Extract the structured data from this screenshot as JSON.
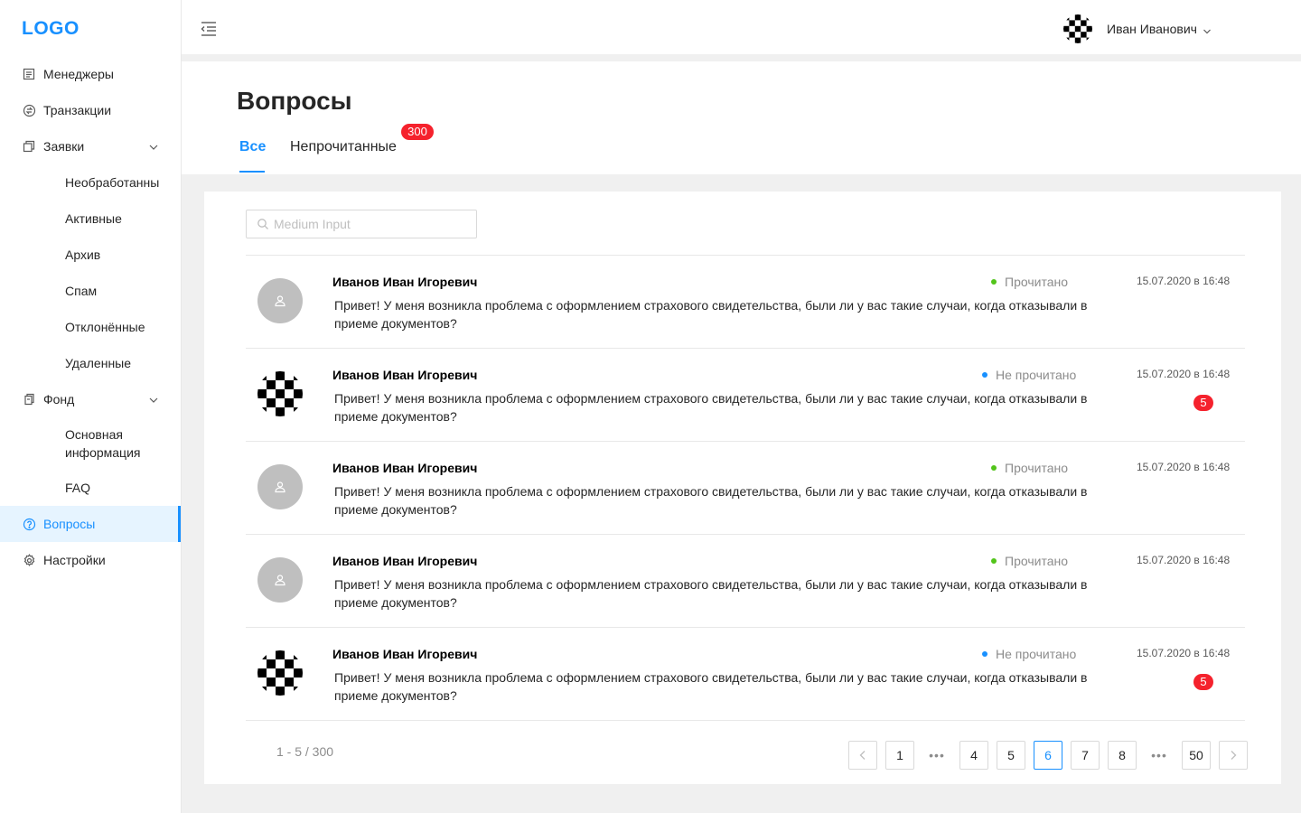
{
  "logo": "LOGO",
  "sidebar": {
    "items": [
      {
        "label": "Менеджеры",
        "icon": "document-list-icon"
      },
      {
        "label": "Транзакции",
        "icon": "transaction-icon"
      },
      {
        "label": "Заявки",
        "icon": "copy-icon",
        "expanded": true
      },
      {
        "label": "Необработанны"
      },
      {
        "label": "Активные"
      },
      {
        "label": "Архив"
      },
      {
        "label": "Спам"
      },
      {
        "label": "Отклонённые"
      },
      {
        "label": "Удаленные"
      },
      {
        "label": "Фонд",
        "icon": "file-icon",
        "expanded": true
      },
      {
        "label": "Основная информация"
      },
      {
        "label": "FAQ"
      },
      {
        "label": "Вопросы",
        "icon": "question-circle-icon",
        "active": true
      },
      {
        "label": "Настройки",
        "icon": "gear-icon"
      }
    ]
  },
  "header": {
    "user_name": "Иван Иванович"
  },
  "page": {
    "title": "Вопросы",
    "tabs": [
      {
        "label": "Все",
        "active": true
      },
      {
        "label": "Непрочитанные",
        "badge": "300"
      }
    ]
  },
  "search": {
    "placeholder": "Medium Input",
    "value": ""
  },
  "questions": [
    {
      "name": "Иванов Иван Игоревич",
      "message": "Привет! У меня возникла проблема с оформлением страхового свидетельства, были ли у вас такие случаи, когда отказывали в приеме документов?",
      "status": "Прочитано",
      "date": "15.07.2020 в 16:48",
      "badge": "",
      "avatar": "default"
    },
    {
      "name": "Иванов Иван Игоревич",
      "message": "Привет! У меня возникла проблема с оформлением страхового свидетельства, были ли у вас такие случаи, когда отказывали в приеме документов?",
      "status": "Не прочитано",
      "date": "15.07.2020 в 16:48",
      "badge": "5",
      "avatar": "checker"
    },
    {
      "name": "Иванов Иван Игоревич",
      "message": "Привет! У меня возникла проблема с оформлением страхового свидетельства, были ли у вас такие случаи, когда отказывали в приеме документов?",
      "status": "Прочитано",
      "date": "15.07.2020 в 16:48",
      "badge": "",
      "avatar": "default"
    },
    {
      "name": "Иванов Иван Игоревич",
      "message": "Привет! У меня возникла проблема с оформлением страхового свидетельства, были ли у вас такие случаи, когда отказывали в приеме документов?",
      "status": "Прочитано",
      "date": "15.07.2020 в 16:48",
      "badge": "",
      "avatar": "default"
    },
    {
      "name": "Иванов Иван Игоревич",
      "message": "Привет! У меня возникла проблема с оформлением страхового свидетельства, были ли у вас такие случаи, когда отказывали в приеме документов?",
      "status": "Не прочитано",
      "date": "15.07.2020 в 16:48",
      "badge": "5",
      "avatar": "checker"
    }
  ],
  "pagination": {
    "total_text": "1 - 5 / 300",
    "pages": [
      "1",
      "4",
      "5",
      "6",
      "7",
      "8",
      "50"
    ],
    "current": "6",
    "ellipsis": "•••"
  },
  "colors": {
    "accent": "#1890ff",
    "read_dot": "#52c41a",
    "unread_dot": "#1890ff",
    "badge": "#f5222d"
  }
}
